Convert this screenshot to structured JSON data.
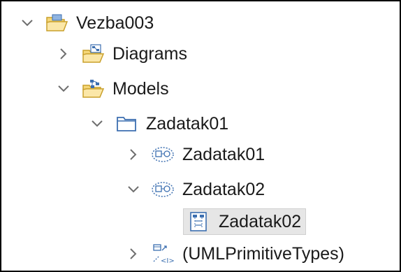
{
  "tree": {
    "root": {
      "label": "Vezba003",
      "icon": "open-folder-icon",
      "expanded": true
    },
    "diagrams": {
      "label": "Diagrams",
      "icon": "diagrams-folder-icon",
      "expanded": false
    },
    "models": {
      "label": "Models",
      "icon": "models-folder-icon",
      "expanded": true
    },
    "zadatak01_folder": {
      "label": "Zadatak01",
      "icon": "package-icon",
      "expanded": true
    },
    "zadatak01_collab": {
      "label": "Zadatak01",
      "icon": "collaboration-icon",
      "expanded": false
    },
    "zadatak02_collab": {
      "label": "Zadatak02",
      "icon": "collaboration-icon",
      "expanded": true
    },
    "zadatak02_diagram": {
      "label": "Zadatak02",
      "icon": "sequence-diagram-icon",
      "selected": true
    },
    "primitive_types": {
      "label": "(UMLPrimitiveTypes)",
      "icon": "primitive-types-icon",
      "expanded": false
    }
  },
  "colors": {
    "chevron": "#6e6e6e",
    "folder_yellow": "#f5d77a",
    "folder_outline": "#c9a02b",
    "package_blue": "#3c6fb0",
    "selection_bg": "#e6e6e6"
  }
}
